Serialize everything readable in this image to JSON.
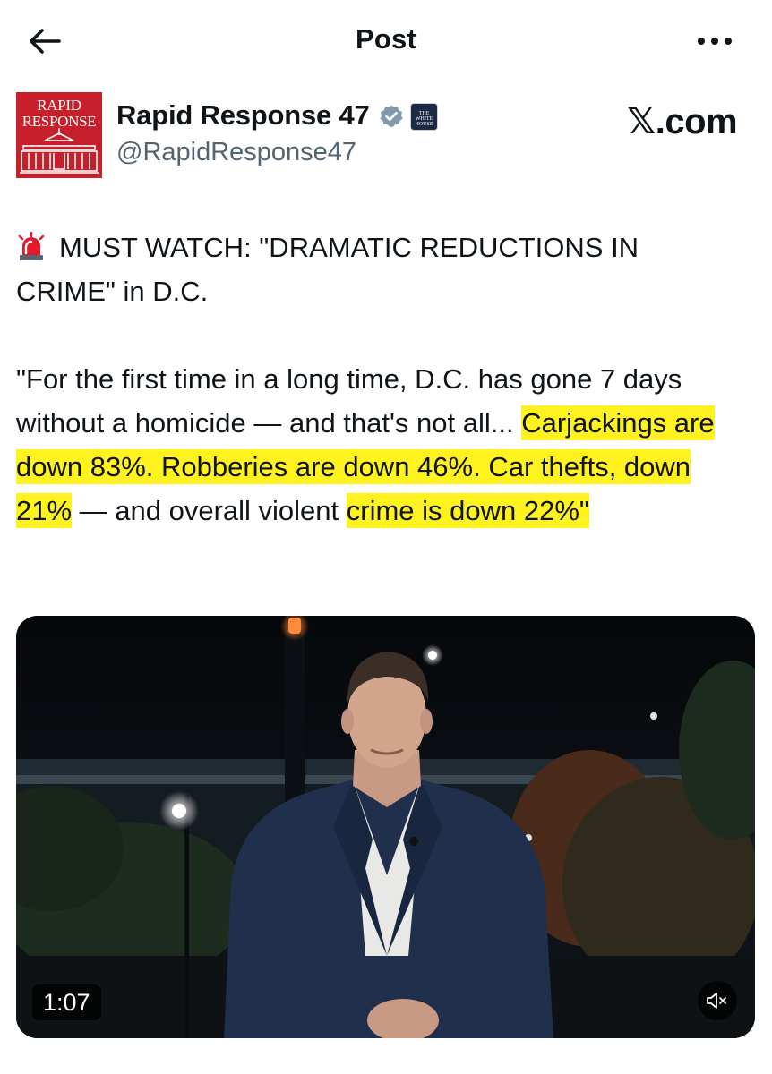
{
  "topbar": {
    "title": "Post",
    "back_icon": "arrow-left-icon",
    "more_icon": "more-horizontal-icon"
  },
  "author": {
    "avatar_text_line1": "RAPID",
    "avatar_text_line2": "RESPONSE",
    "avatar_color": "#c8202a",
    "display_name": "Rapid Response 47",
    "handle": "@RapidResponse47",
    "verified_icon": "verified-badge-icon",
    "affiliation_line1": "THE",
    "affiliation_line2": "WHITE",
    "affiliation_line3": "HOUSE"
  },
  "watermark": "𝕏.com",
  "post": {
    "siren_icon": "police-siren-icon",
    "headline": "MUST WATCH: \"DRAMATIC REDUCTIONS IN CRIME\" in D.C.",
    "quote_plain": "\"For the first time in a long time, D.C. has gone 7 days without a homicide — and that's not all...",
    "quote_highlighted_1": "Carjackings are down 83%. Robberies are down 46%. Car thefts, down 21%",
    "quote_middle": " — and overall violent ",
    "quote_highlighted_2": "crime is down 22%\"",
    "highlight_color": "#fff21f"
  },
  "video": {
    "duration": "1:07",
    "mute_icon": "volume-muted-icon"
  }
}
